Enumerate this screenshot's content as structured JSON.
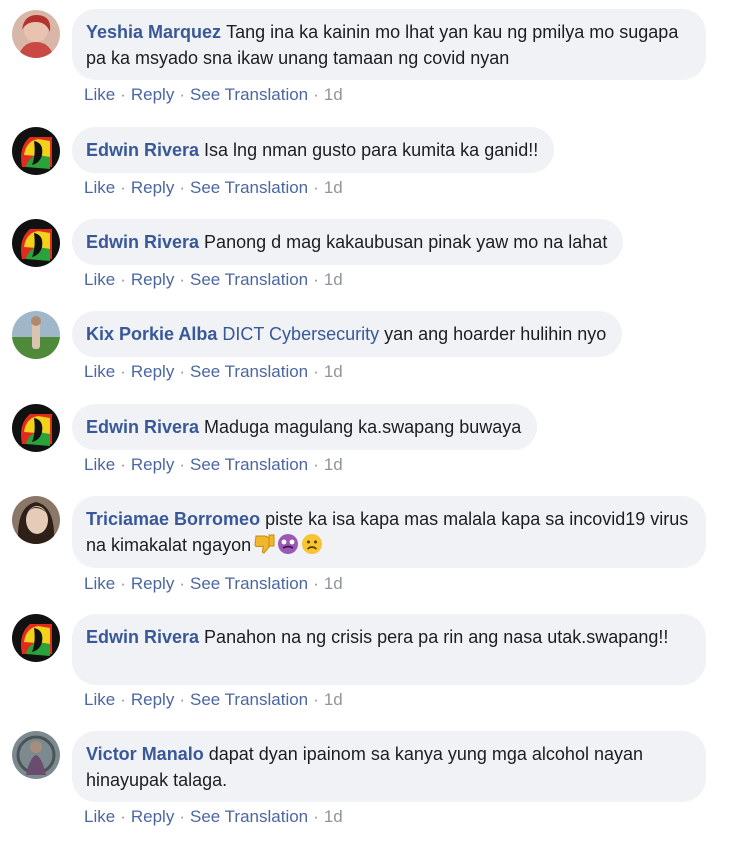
{
  "actions": {
    "like": "Like",
    "reply": "Reply",
    "translate": "See Translation",
    "sep": "·"
  },
  "comments": [
    {
      "author": "Yeshia Marquez",
      "text": "Tang ina ka kainin mo lhat yan kau ng pmilya mo sugapa pa ka msyado sna ikaw unang tamaan ng covid nyan",
      "time": "1d",
      "avatar": "woman-red-avatar"
    },
    {
      "author": "Edwin Rivera",
      "text": "Isa lng nman gusto para kumita ka ganid!!",
      "time": "1d",
      "avatar": "rasta-lion-avatar"
    },
    {
      "author": "Edwin Rivera",
      "text": "Panong d mag kakaubusan pinak yaw mo na lahat",
      "time": "1d",
      "avatar": "rasta-lion-avatar"
    },
    {
      "author": "Kix Porkie Alba",
      "mention": "DICT Cybersecurity",
      "text": "yan ang hoarder hulihin nyo",
      "time": "1d",
      "avatar": "outdoor-person-avatar"
    },
    {
      "author": "Edwin Rivera",
      "text": "Maduga magulang ka.swapang buwaya",
      "time": "1d",
      "avatar": "rasta-lion-avatar"
    },
    {
      "author": "Triciamae Borromeo",
      "text": "piste ka isa kapa mas malala kapa sa incovid19 virus na kimakalat ngayon",
      "time": "1d",
      "avatar": "woman-portrait-avatar",
      "emojis": [
        "thumbs-down-icon",
        "dizzy-face-icon",
        "frowning-face-icon"
      ]
    },
    {
      "author": "Edwin Rivera",
      "text": "Panahon na ng crisis pera pa rin ang nasa utak.swapang!!",
      "time": "1d",
      "avatar": "rasta-lion-avatar"
    },
    {
      "author": "Victor Manalo",
      "text": "dapat dyan ipainom sa kanya yung mga alcohol nayan hinayupak talaga.",
      "time": "1d",
      "avatar": "man-outdoor-avatar"
    }
  ]
}
